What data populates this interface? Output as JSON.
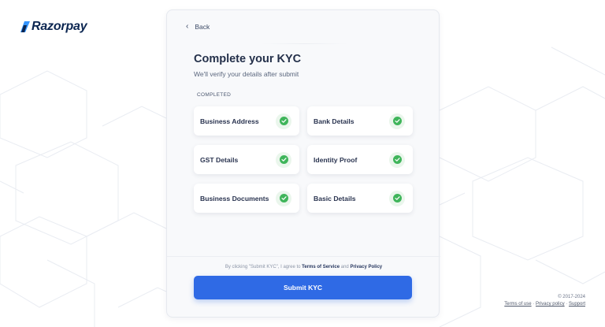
{
  "brand": {
    "name": "Razorpay",
    "color": "#0c2651",
    "logo_accent": "#3395ff"
  },
  "card": {
    "back_label": "Back",
    "title": "Complete your KYC",
    "subtitle": "We'll verify your details after submit",
    "section_label": "COMPLETED",
    "items": [
      {
        "label": "Business Address",
        "status": "completed",
        "icon": "check-circle-icon"
      },
      {
        "label": "Bank Details",
        "status": "completed",
        "icon": "check-circle-icon"
      },
      {
        "label": "GST Details",
        "status": "completed",
        "icon": "check-circle-icon"
      },
      {
        "label": "Identity Proof",
        "status": "completed",
        "icon": "check-circle-icon"
      },
      {
        "label": "Business Documents",
        "status": "completed",
        "icon": "check-circle-icon"
      },
      {
        "label": "Basic Details",
        "status": "completed",
        "icon": "check-circle-icon"
      }
    ],
    "consent_prefix": "By clicking \"Submit KYC\", I agree to",
    "terms_link": "Terms of Service",
    "consent_and": "and",
    "privacy_link": "Privacy Policy",
    "submit_label": "Submit KYC"
  },
  "footer": {
    "copyright": "© 2017-2024",
    "terms_link": "Terms of use",
    "privacy_link": "Privacy policy",
    "support_link": "Support",
    "separator": "·"
  },
  "colors": {
    "accent": "#2f6ae5",
    "success": "#3fb55a",
    "card_bg": "#f8f9fb"
  }
}
